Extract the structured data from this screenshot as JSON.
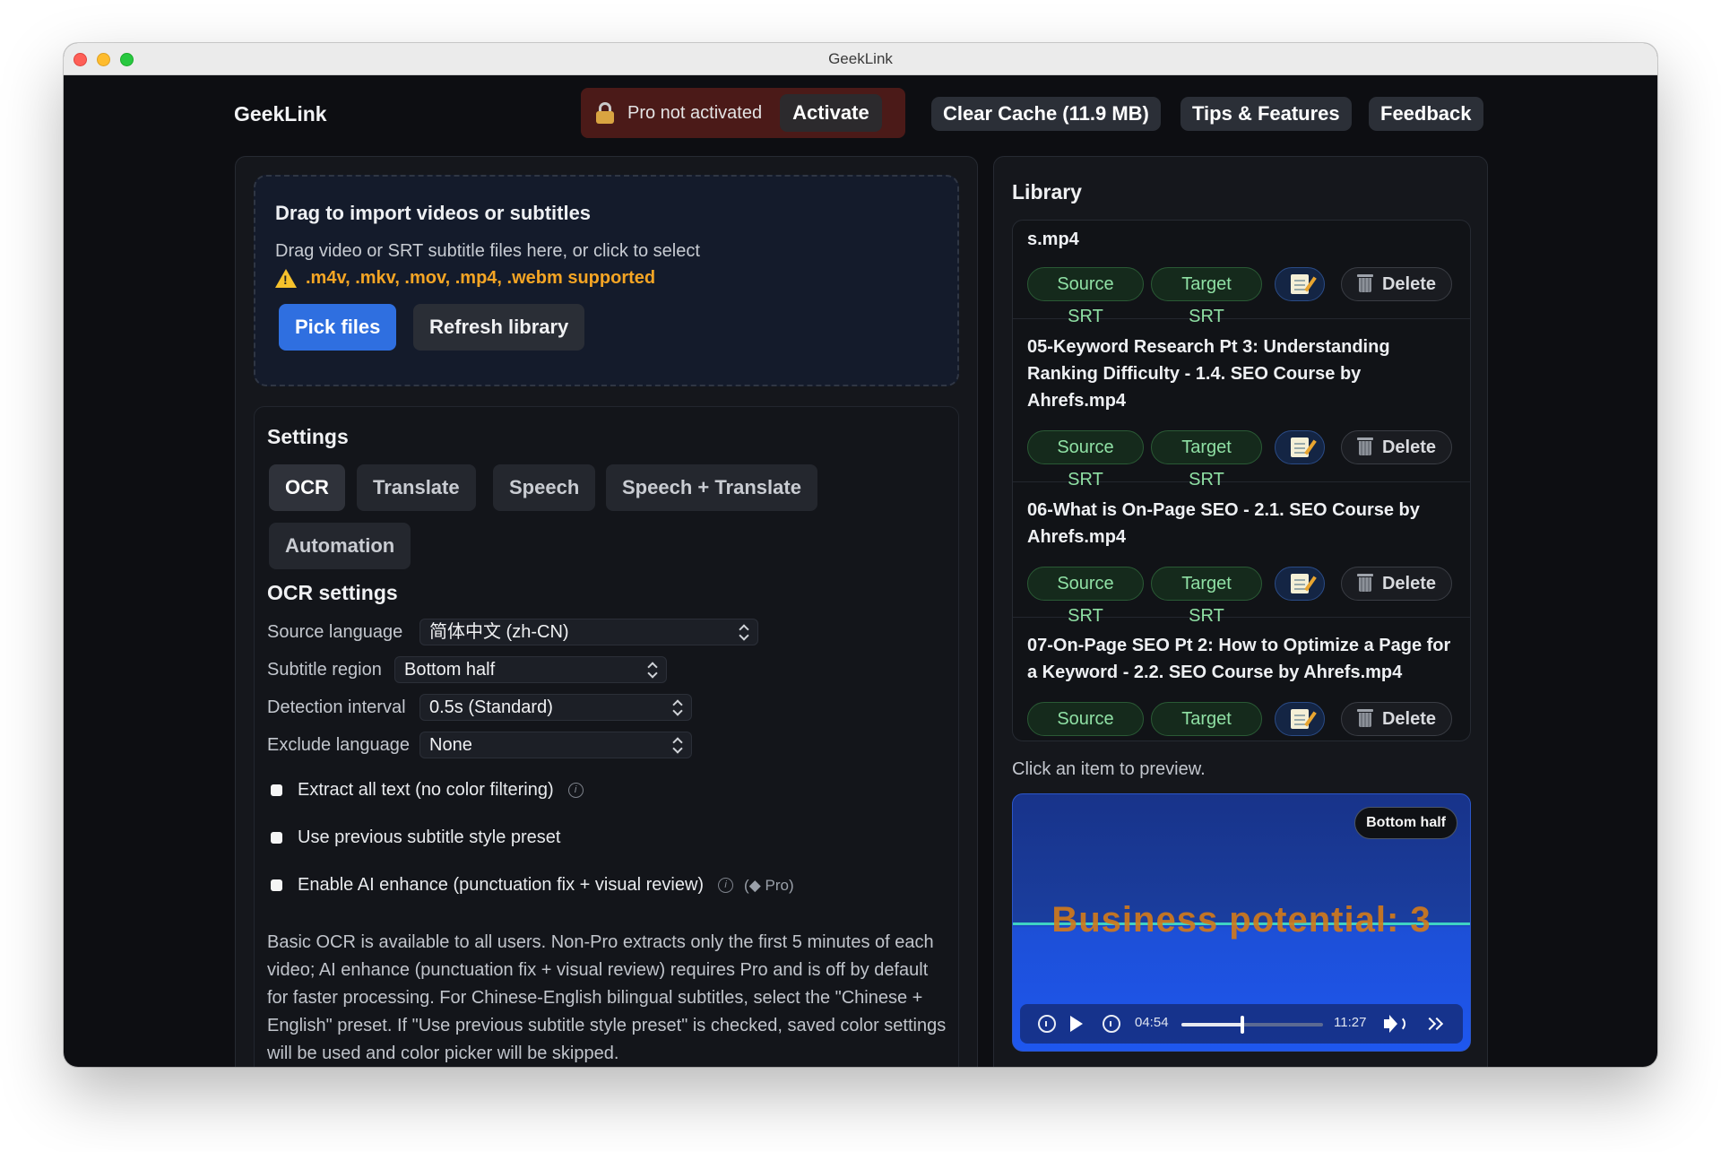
{
  "window": {
    "title": "GeekLink"
  },
  "header": {
    "app_name": "GeekLink",
    "pro_status": "Pro not activated",
    "activate_label": "Activate",
    "clear_cache_label": "Clear Cache (11.9 MB)",
    "tips_label": "Tips & Features",
    "feedback_label": "Feedback"
  },
  "import": {
    "title": "Drag to import videos or subtitles",
    "subtitle": "Drag video or SRT subtitle files here, or click to select",
    "supported": ".m4v, .mkv, .mov, .mp4, .webm supported",
    "pick_label": "Pick files",
    "refresh_label": "Refresh library"
  },
  "settings": {
    "title": "Settings",
    "tabs": [
      "OCR",
      "Translate",
      "Speech",
      "Speech + Translate",
      "Automation"
    ],
    "active_tab": "OCR",
    "ocr_title": "OCR settings",
    "fields": [
      {
        "label": "Source language",
        "value": "简体中文 (zh-CN)"
      },
      {
        "label": "Subtitle region",
        "value": "Bottom half"
      },
      {
        "label": "Detection interval",
        "value": "0.5s (Standard)"
      },
      {
        "label": "Exclude language",
        "value": "None"
      }
    ],
    "checkboxes": [
      {
        "label": "Extract all text (no color filtering)",
        "checked": false
      },
      {
        "label": "Use previous subtitle style preset",
        "checked": false
      },
      {
        "label": "Enable AI enhance (punctuation fix + visual review)",
        "checked": false,
        "tag": "(◆ Pro)"
      }
    ],
    "info_glyph": "i",
    "help": "Basic OCR is available to all users. Non-Pro extracts only the first 5 minutes of each video; AI enhance (punctuation fix + visual review) requires Pro and is off by default for faster processing. For Chinese-English bilingual subtitles, select the \"Chinese + English\" preset. If \"Use previous subtitle style preset\" is checked, saved color settings will be used and color picker will be skipped."
  },
  "library": {
    "title": "Library",
    "items": [
      {
        "name": "s.mp4"
      },
      {
        "name": "05-Keyword Research Pt 3: Understanding Ranking Difficulty - 1.4. SEO Course by Ahrefs.mp4"
      },
      {
        "name": "06-What is On-Page SEO - 2.1. SEO Course by Ahrefs.mp4"
      },
      {
        "name": "07-On-Page SEO Pt 2: How to Optimize a Page for a Keyword - 2.2. SEO Course by Ahrefs.mp4"
      }
    ],
    "source_label": "Source SRT",
    "target_label": "Target SRT",
    "delete_label": "Delete",
    "preview_hint": "Click an item to preview."
  },
  "player": {
    "region_badge": "Bottom half",
    "subtitle": "Business potential: 3",
    "current_time": "04:54",
    "duration": "11:27",
    "progress": 0.428
  }
}
